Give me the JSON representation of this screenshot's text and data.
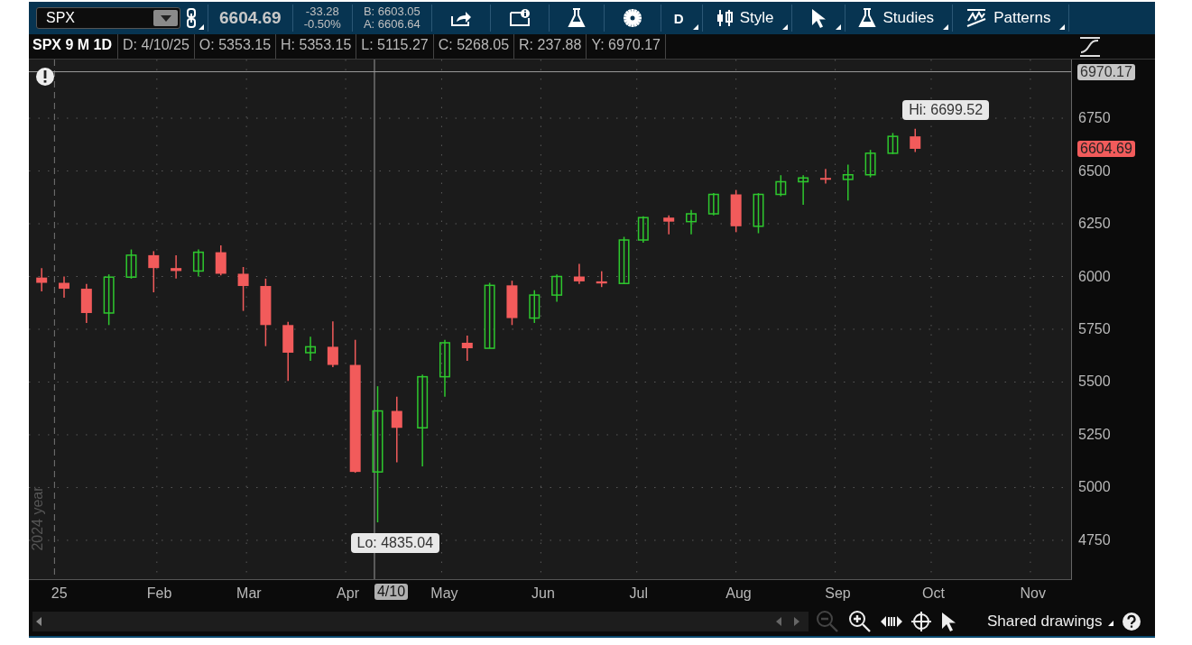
{
  "toolbar": {
    "symbol": "SPX",
    "last_price": "6604.69",
    "net_change": "-33.28",
    "percent_change": "-0.50%",
    "bid": "B: 6603.05",
    "ask": "A: 6606.64",
    "buttons": [
      {
        "kind": "share",
        "menu": false
      },
      {
        "kind": "info",
        "menu": false
      },
      {
        "kind": "flask",
        "menu": false
      },
      {
        "kind": "gear",
        "menu": false
      },
      {
        "kind": "text",
        "label": "D",
        "menu": true
      },
      {
        "kind": "candles",
        "label": "Style",
        "menu": true
      },
      {
        "kind": "pointer",
        "menu": true
      },
      {
        "kind": "flask",
        "label": "Studies",
        "menu": true
      },
      {
        "kind": "patterns",
        "label": "Patterns",
        "menu": true
      }
    ]
  },
  "info_bar": {
    "title": "SPX 9 M 1D",
    "fields": [
      "D: 4/10/25",
      "O: 5353.15",
      "H: 5353.15",
      "L: 5115.27",
      "C: 5268.05",
      "R: 237.88",
      "Y: 6970.17"
    ]
  },
  "chart": {
    "year_label": "2024 year",
    "last_price_badge": "6604.69",
    "chart_data": {
      "type": "candlestick",
      "grid": true,
      "xlim": [
        "2024-12-23",
        "2025-11-14"
      ],
      "ylim": [
        4566,
        7028
      ],
      "yticks": [
        4750,
        5000,
        5250,
        5500,
        5750,
        6000,
        6250,
        6500,
        6750
      ],
      "xticks": [
        {
          "value": "2025-01-01",
          "label": "25"
        },
        {
          "value": "2025-02-01",
          "label": "Feb"
        },
        {
          "value": "2025-03-01",
          "label": "Mar"
        },
        {
          "value": "2025-04-01",
          "label": "Apr"
        },
        {
          "value": "2025-05-01",
          "label": "May"
        },
        {
          "value": "2025-06-01",
          "label": "Jun"
        },
        {
          "value": "2025-07-01",
          "label": "Jul"
        },
        {
          "value": "2025-08-01",
          "label": "Aug"
        },
        {
          "value": "2025-09-01",
          "label": "Sep"
        },
        {
          "value": "2025-10-01",
          "label": "Oct"
        },
        {
          "value": "2025-11-01",
          "label": "Nov"
        }
      ],
      "x": [
        "2024-12-27",
        "2025-01-03",
        "2025-01-10",
        "2025-01-17",
        "2025-01-24",
        "2025-01-31",
        "2025-02-07",
        "2025-02-14",
        "2025-02-21",
        "2025-02-28",
        "2025-03-07",
        "2025-03-14",
        "2025-03-21",
        "2025-03-28",
        "2025-04-04",
        "2025-04-11",
        "2025-04-17",
        "2025-04-25",
        "2025-05-02",
        "2025-05-09",
        "2025-05-16",
        "2025-05-23",
        "2025-05-30",
        "2025-06-06",
        "2025-06-13",
        "2025-06-20",
        "2025-06-27",
        "2025-07-03",
        "2025-07-11",
        "2025-07-18",
        "2025-07-25",
        "2025-08-01",
        "2025-08-08",
        "2025-08-15",
        "2025-08-22",
        "2025-08-29",
        "2025-09-05",
        "2025-09-12",
        "2025-09-19",
        "2025-09-26"
      ],
      "ohlc": [
        [
          5995,
          6040,
          5930,
          5970
        ],
        [
          5970,
          6000,
          5900,
          5942
        ],
        [
          5942,
          5965,
          5780,
          5827
        ],
        [
          5827,
          6010,
          5770,
          5997
        ],
        [
          5997,
          6128,
          5990,
          6101
        ],
        [
          6101,
          6120,
          5925,
          6040
        ],
        [
          6040,
          6100,
          5990,
          6026
        ],
        [
          6026,
          6128,
          6000,
          6115
        ],
        [
          6115,
          6147,
          6005,
          6013
        ],
        [
          6013,
          6045,
          5837,
          5955
        ],
        [
          5955,
          5990,
          5670,
          5770
        ],
        [
          5770,
          5785,
          5505,
          5639
        ],
        [
          5639,
          5715,
          5600,
          5667
        ],
        [
          5667,
          5787,
          5570,
          5581
        ],
        [
          5581,
          5700,
          5070,
          5074
        ],
        [
          5074,
          5480,
          4835.04,
          5363
        ],
        [
          5363,
          5430,
          5120,
          5283
        ],
        [
          5283,
          5535,
          5100,
          5525
        ],
        [
          5525,
          5700,
          5430,
          5686
        ],
        [
          5686,
          5720,
          5600,
          5660
        ],
        [
          5660,
          5970,
          5660,
          5958
        ],
        [
          5958,
          5980,
          5770,
          5803
        ],
        [
          5803,
          5935,
          5780,
          5912
        ],
        [
          5912,
          6010,
          5880,
          6000
        ],
        [
          6000,
          6060,
          5965,
          5977
        ],
        [
          5977,
          6025,
          5950,
          5967
        ],
        [
          5967,
          6188,
          5965,
          6173
        ],
        [
          6173,
          6285,
          6160,
          6279
        ],
        [
          6279,
          6290,
          6200,
          6260
        ],
        [
          6260,
          6315,
          6200,
          6297
        ],
        [
          6297,
          6395,
          6290,
          6389
        ],
        [
          6389,
          6410,
          6210,
          6238
        ],
        [
          6238,
          6395,
          6205,
          6389
        ],
        [
          6389,
          6480,
          6380,
          6449
        ],
        [
          6449,
          6480,
          6340,
          6467
        ],
        [
          6467,
          6510,
          6440,
          6460
        ],
        [
          6460,
          6530,
          6360,
          6482
        ],
        [
          6482,
          6600,
          6470,
          6584
        ],
        [
          6584,
          6680,
          6580,
          6664
        ],
        [
          6664,
          6699.52,
          6590,
          6605
        ]
      ],
      "ref_lines": [
        {
          "axis": "x",
          "value": "2024-12-31"
        },
        {
          "axis": "y",
          "value": 6970.17,
          "label": "6970.17"
        },
        {
          "axis": "x",
          "value": "2025-04-10",
          "label": "4/10"
        }
      ],
      "annotations": [
        {
          "text": "Hi: 6699.52",
          "x": "2025-09-26",
          "y": 6699.52
        },
        {
          "text": "Lo: 4835.04",
          "x": "2025-04-11",
          "y": 4835.04
        }
      ]
    }
  },
  "bottom_bar": {
    "shared_drawings": "Shared drawings",
    "zoom_out_disabled": true
  }
}
